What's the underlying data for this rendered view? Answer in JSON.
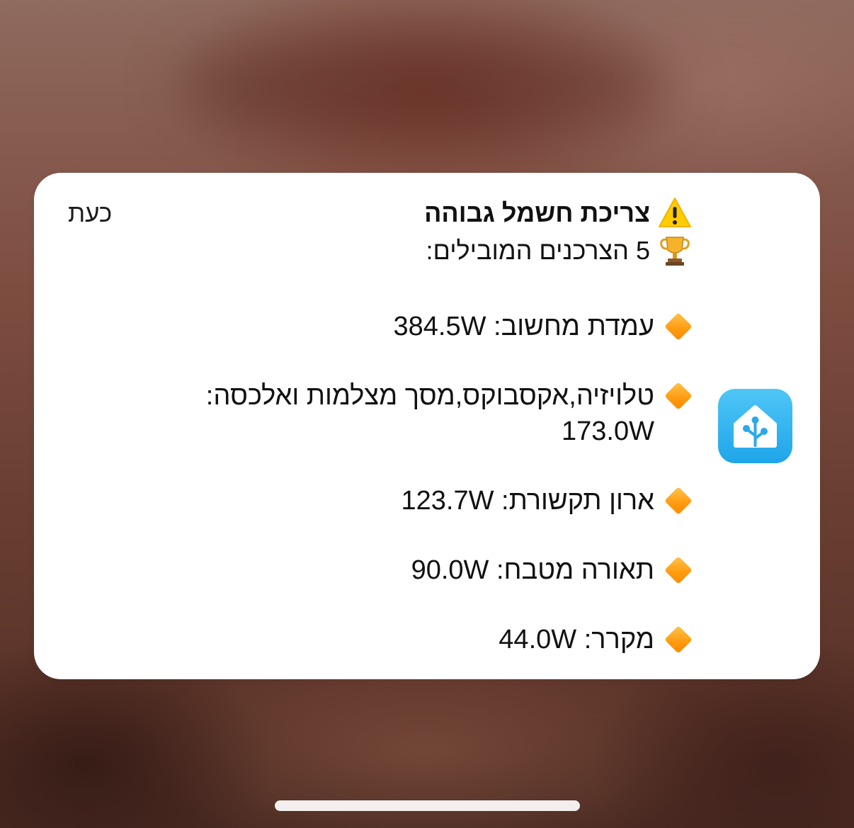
{
  "notification": {
    "time": "כעת",
    "app_icon": "home-assistant-icon",
    "title": "צריכת חשמל גבוהה",
    "title_emoji": "warning-icon",
    "subtitle": "5 הצרכנים המובילים:",
    "subtitle_emoji": "trophy-icon",
    "items": [
      {
        "label": "עמדת מחשוב:",
        "value": "384.5W"
      },
      {
        "label": "טלויזיה,אקסבוקס,מסך מצלמות ואלכסה:",
        "value": "173.0W"
      },
      {
        "label": "ארון תקשורת:",
        "value": "123.7W"
      },
      {
        "label": "תאורה מטבח:",
        "value": "90.0W"
      },
      {
        "label": "מקרר:",
        "value": "44.0W"
      }
    ],
    "bullet_icon": "orange-diamond-icon"
  },
  "colors": {
    "card": "#ffffff",
    "accent_blue": "#1ea5ea",
    "bullet_orange": "#ff9a0f",
    "warning_yellow": "#ffcc00"
  }
}
